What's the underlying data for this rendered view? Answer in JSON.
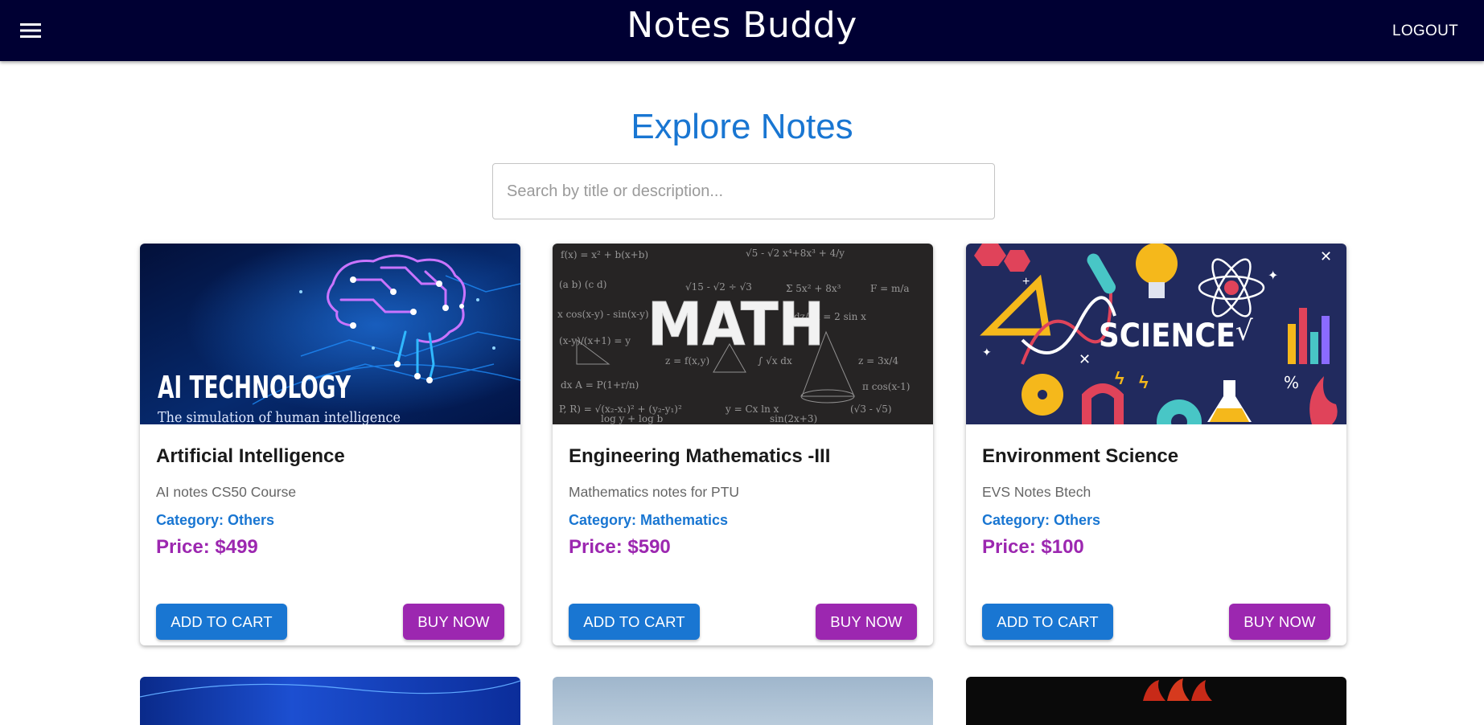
{
  "appbar": {
    "title": "Notes Buddy",
    "logout_label": "LOGOUT",
    "menu_icon": "menu-icon"
  },
  "page": {
    "heading": "Explore Notes"
  },
  "search": {
    "placeholder": "Search by title or description...",
    "value": ""
  },
  "cards": [
    {
      "image_text": "AI TECHNOLOGY",
      "image_subtext": "The simulation of human intelligence",
      "title": "Artificial Intelligence",
      "description": "AI notes CS50 Course",
      "category_label": "Category: ",
      "category": "Others",
      "price": "Price: $499",
      "cart_label": "ADD TO CART",
      "buy_label": "BUY NOW"
    },
    {
      "image_text": "MATH",
      "title": "Engineering Mathematics -III",
      "description": "Mathematics notes for PTU",
      "category_label": "Category: ",
      "category": "Mathematics",
      "price": "Price: $590",
      "cart_label": "ADD TO CART",
      "buy_label": "BUY NOW"
    },
    {
      "image_text": "SCIENCE",
      "title": "Environment Science",
      "description": "EVS Notes Btech",
      "category_label": "Category: ",
      "category": "Others",
      "price": "Price: $100",
      "cart_label": "ADD TO CART",
      "buy_label": "BUY NOW"
    }
  ],
  "colors": {
    "appbar": "#000033",
    "primary": "#1976d2",
    "secondary": "#9c27b0"
  }
}
